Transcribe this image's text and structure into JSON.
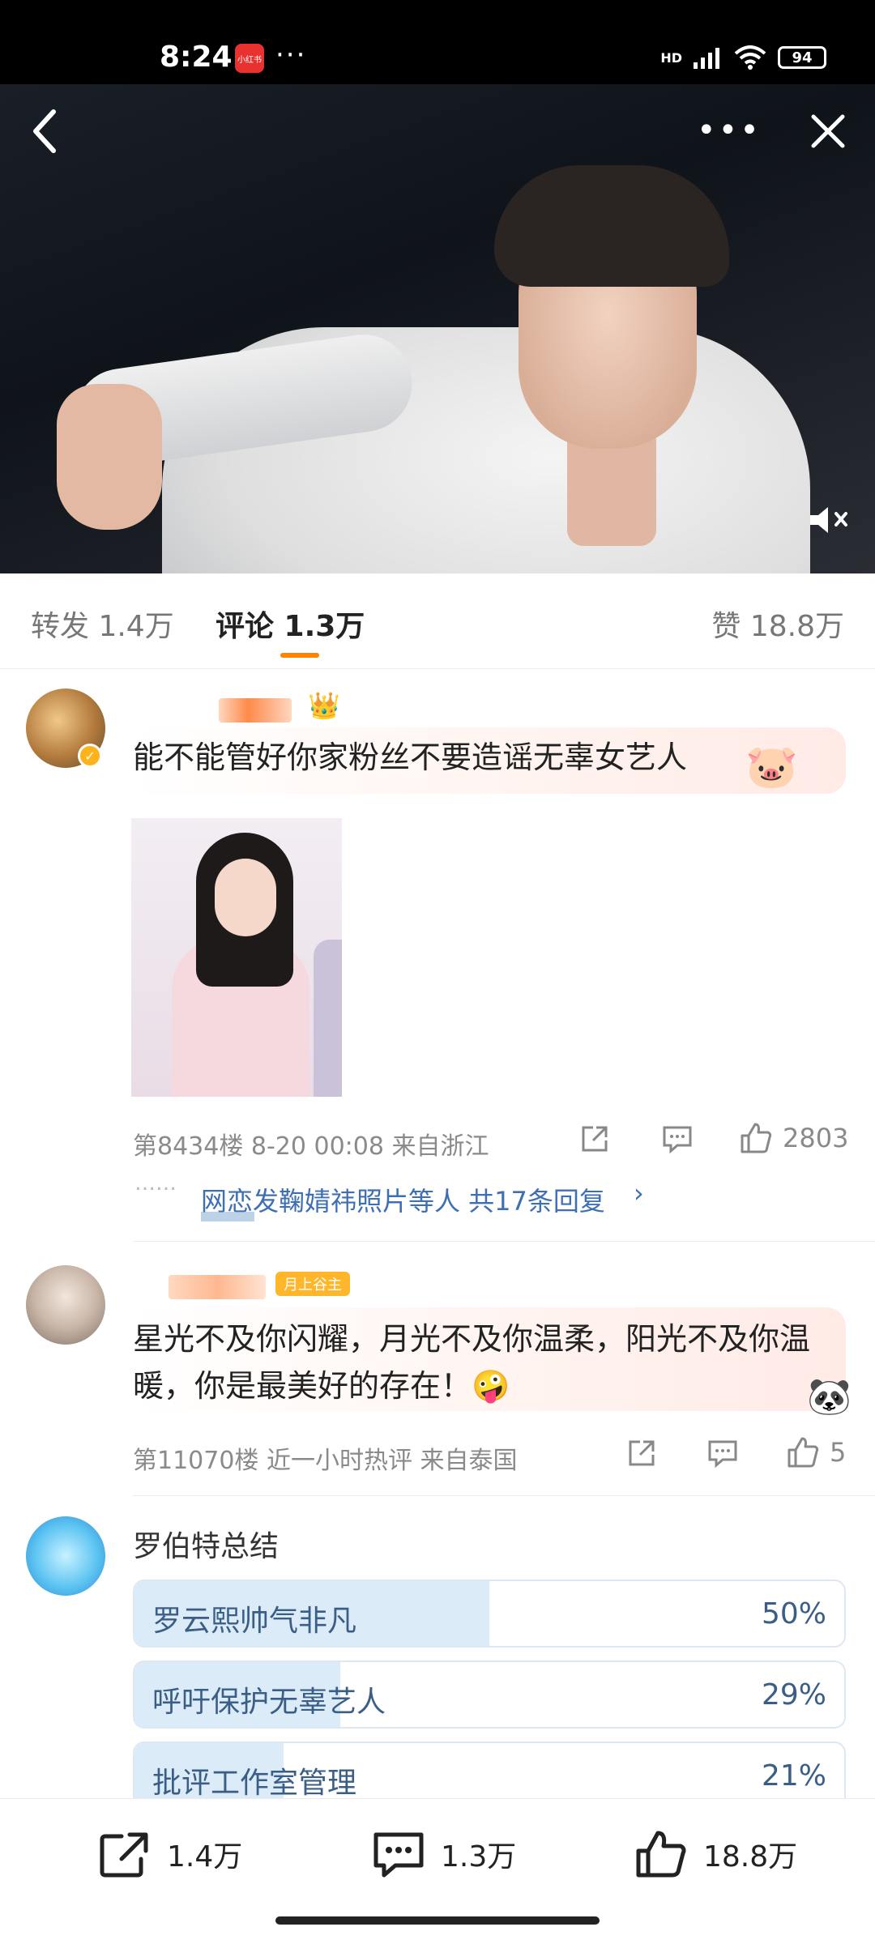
{
  "status_bar": {
    "time": "8:24",
    "app_badge": "小红书",
    "battery": "94",
    "network": "HD"
  },
  "video": {
    "more_icon": "more-dots-icon",
    "mute_icon": "mute-icon"
  },
  "tabs": {
    "repost": "转发 1.4万",
    "comments": "评论 1.3万",
    "likes": "赞 18.8万",
    "active": "comments",
    "accent_color": "#ff8200"
  },
  "comments": [
    {
      "text": "能不能管好你家粉丝不要造谣无辜女艺人",
      "floor_time_location": "第8434楼  8-20 00:08  来自浙江",
      "like_count": "2803",
      "reply_summary": "网恋发鞠婧祎照片等人  共17条回复",
      "reply_arrow": "›"
    },
    {
      "badge": "月上谷主",
      "text": "星光不及你闪耀，月光不及你温柔，阳光不及你温暖，你是最美好的存在！🤪",
      "floor_time_location": "第11070楼  近一小时热评  来自泰国",
      "like_count": "5"
    }
  ],
  "poll": {
    "title": "罗伯特总结",
    "options": [
      {
        "label": "罗云熙帅气非凡",
        "percent_text": "50%",
        "percent": 50
      },
      {
        "label": "呼吁保护无辜艺人",
        "percent_text": "29%",
        "percent": 29
      },
      {
        "label": "批评工作室管理",
        "percent_text": "21%",
        "percent": 21
      }
    ]
  },
  "bottom_bar": {
    "share_count": "1.4万",
    "comment_count": "1.3万",
    "like_count": "18.8万"
  }
}
